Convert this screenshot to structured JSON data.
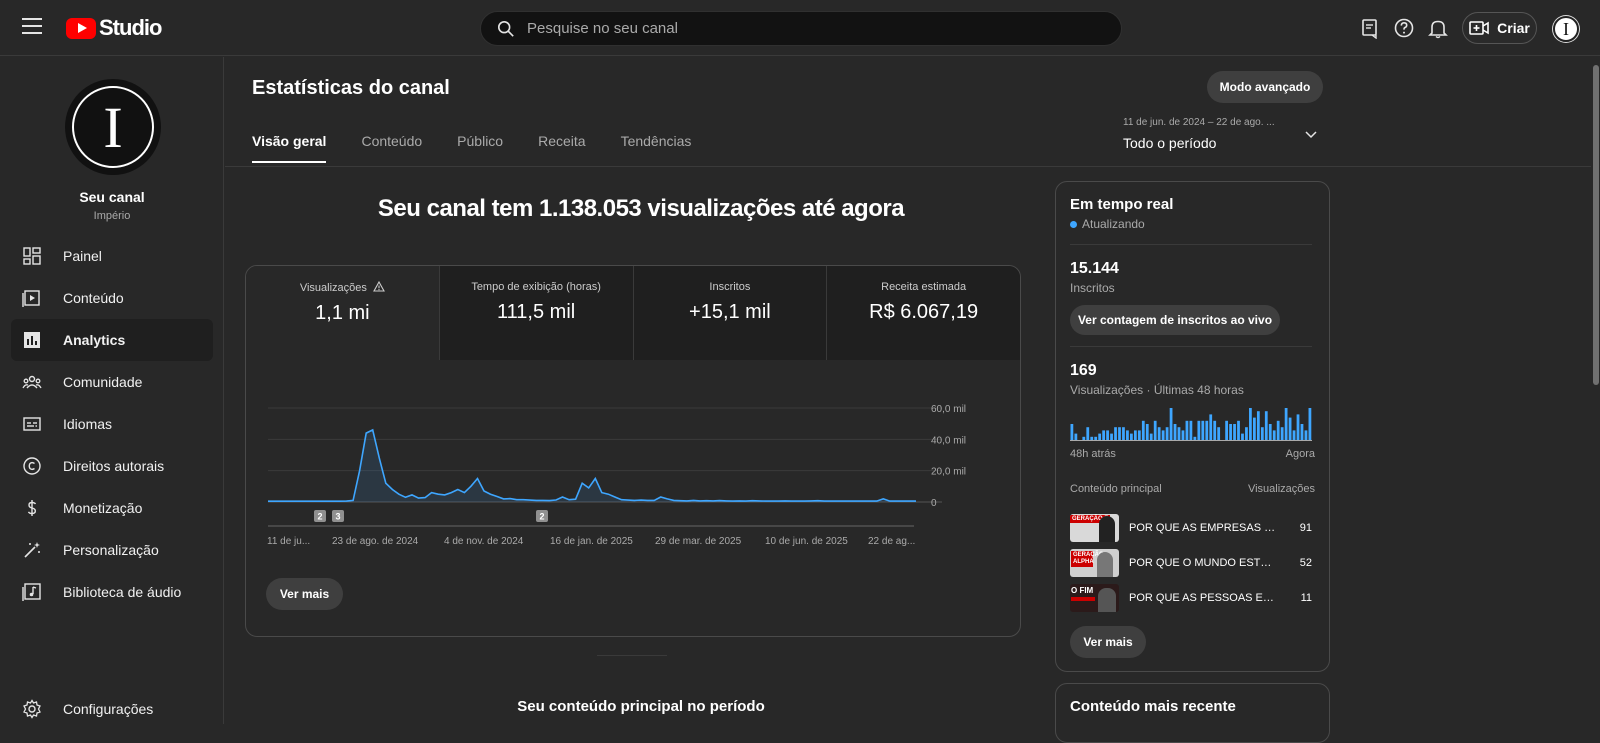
{
  "app": {
    "logo_text": "Studio",
    "search_placeholder": "Pesquise no seu canal",
    "create_label": "Criar",
    "avatar_letter": "I"
  },
  "channel": {
    "name": "Seu canal",
    "subtitle": "Império",
    "avatar_letter": "I"
  },
  "sidebar": {
    "items": [
      {
        "label": "Painel",
        "icon": "dashboard-icon"
      },
      {
        "label": "Conteúdo",
        "icon": "content-icon"
      },
      {
        "label": "Analytics",
        "icon": "analytics-icon",
        "active": true
      },
      {
        "label": "Comunidade",
        "icon": "community-icon"
      },
      {
        "label": "Idiomas",
        "icon": "subtitles-icon"
      },
      {
        "label": "Direitos autorais",
        "icon": "copyright-icon"
      },
      {
        "label": "Monetização",
        "icon": "dollar-icon"
      },
      {
        "label": "Personalização",
        "icon": "magic-wand-icon"
      },
      {
        "label": "Biblioteca de áudio",
        "icon": "audio-library-icon"
      }
    ],
    "settings_label": "Configurações"
  },
  "page": {
    "title": "Estatísticas do canal",
    "advanced_label": "Modo avançado",
    "tabs": [
      "Visão geral",
      "Conteúdo",
      "Público",
      "Receita",
      "Tendências"
    ],
    "period_range": "11 de jun. de 2024 – 22 de ago. ...",
    "period_value": "Todo o período",
    "headline": "Seu canal tem 1.138.053 visualizações até agora",
    "see_more": "Ver mais",
    "top_content_title": "Seu conteúdo principal no período"
  },
  "metrics": [
    {
      "label": "Visualizações",
      "value": "1,1 mi"
    },
    {
      "label": "Tempo de exibição (horas)",
      "value": "111,5 mil"
    },
    {
      "label": "Inscritos",
      "value": "+15,1 mil"
    },
    {
      "label": "Receita estimada",
      "value": "R$ 6.067,19"
    }
  ],
  "chart_data": {
    "type": "line",
    "series": [
      {
        "values": [
          500,
          500,
          500,
          500,
          500,
          500,
          500,
          500,
          500,
          500,
          500,
          500,
          600,
          1000,
          20000,
          44000,
          46000,
          28000,
          12000,
          8000,
          5000,
          3000,
          4500,
          2500,
          2800,
          6000,
          5000,
          4500,
          6000,
          8000,
          6000,
          10000,
          15000,
          7000,
          5000,
          3500,
          2000,
          2200,
          1500,
          1500,
          1200,
          1000,
          1000,
          900,
          1300,
          3200,
          1500,
          1800,
          12000,
          9000,
          15000,
          6000,
          5000,
          3200,
          1500,
          1200,
          1000,
          1200,
          1000,
          1000,
          3200,
          2000,
          1000,
          800,
          700,
          1000,
          700,
          800,
          700,
          900,
          700,
          600,
          700,
          600,
          800,
          700,
          600,
          600,
          600,
          700,
          600,
          600,
          600,
          700,
          800,
          600,
          600,
          600,
          600,
          600,
          600,
          600,
          600,
          600,
          2000,
          600,
          600,
          600,
          600,
          600
        ]
      }
    ],
    "x_tick_labels": [
      "11 de ju...",
      "23 de ago. de 2024",
      "4 de nov. de 2024",
      "16 de jan. de 2025",
      "29 de mar. de 2025",
      "10 de jun. de 2025",
      "22 de ag..."
    ],
    "y_tick_labels": [
      "60,0 mil",
      "40,0 mil",
      "20,0 mil",
      "0"
    ],
    "ylim": [
      0,
      60000
    ],
    "markers": [
      "2",
      "3",
      "2"
    ],
    "color": "#3ea6ff"
  },
  "realtime": {
    "title": "Em tempo real",
    "status": "Atualizando",
    "subs_value": "15.144",
    "subs_label": "Inscritos",
    "live_button": "Ver contagem de inscritos ao vivo",
    "views_value": "169",
    "views_label": "Visualizações · Últimas 48 horas",
    "bars": [
      5,
      2,
      0,
      1,
      4,
      1,
      1,
      2,
      3,
      3,
      2,
      4,
      4,
      4,
      3,
      2,
      3,
      3,
      6,
      5,
      2,
      6,
      4,
      3,
      4,
      10,
      5,
      4,
      3,
      6,
      6,
      1,
      6,
      6,
      6,
      8,
      6,
      4,
      0,
      6,
      5,
      5,
      6,
      2,
      4,
      10,
      7,
      9,
      4,
      9,
      5,
      3,
      6,
      4,
      10,
      7,
      3,
      8,
      5,
      3,
      10
    ],
    "bar_color": "#3ea6ff",
    "left_label": "48h atrás",
    "right_label": "Agora",
    "top_header": "Conteúdo principal",
    "top_header_right": "Visualizações",
    "top": [
      {
        "title": "POR QUE AS EMPRESAS NÃO...",
        "views": "91"
      },
      {
        "title": "POR QUE O MUNDO ESTÁ P...",
        "views": "52"
      },
      {
        "title": "POR QUE AS PESSOAS EST...",
        "views": "11"
      }
    ],
    "thumb_texts": [
      "GERAÇÃO Z",
      "GERAÇÃO ALPHA",
      "O FIM"
    ],
    "see_more": "Ver mais"
  },
  "recent": {
    "title": "Conteúdo mais recente"
  }
}
